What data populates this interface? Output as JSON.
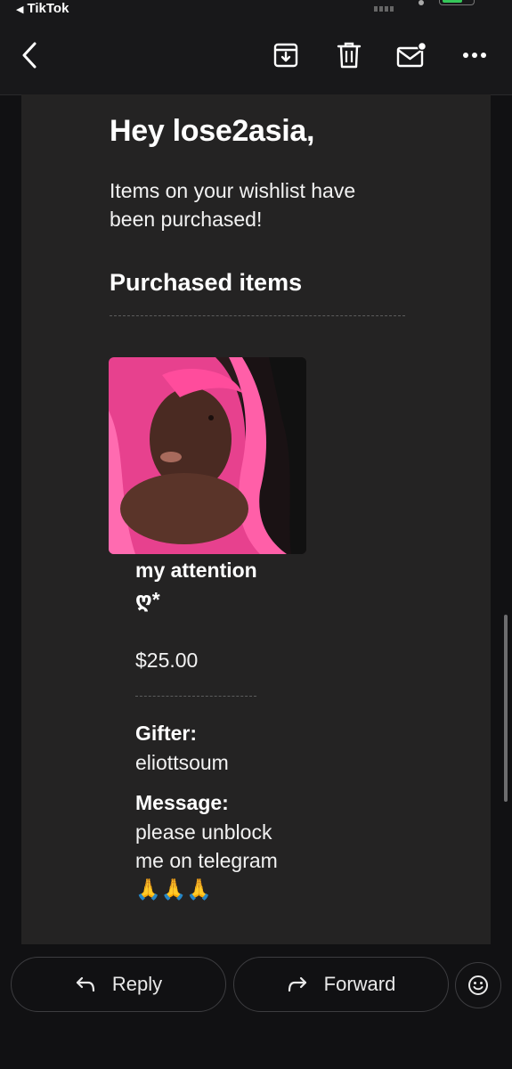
{
  "status_bar": {
    "back_label": "TikTok"
  },
  "toolbar": {
    "icons": [
      "back-chevron-icon",
      "archive-icon",
      "trash-icon",
      "mark-unread-icon",
      "more-icon"
    ]
  },
  "email": {
    "greeting": "Hey lose2asia,",
    "intro": "Items on your wishlist have been purchased!",
    "section_title": "Purchased items",
    "item": {
      "name": "my attention ღ*",
      "price": "$25.00"
    },
    "gifter_label": "Gifter:",
    "gifter": "eliottsoum",
    "message_label": "Message:",
    "message": "please unblock me on telegram 🙏🙏🙏"
  },
  "actions": {
    "reply_label": "Reply",
    "forward_label": "Forward"
  },
  "colors": {
    "background": "#111113",
    "card": "#242323",
    "photo_accent": "#ff2f8f"
  }
}
